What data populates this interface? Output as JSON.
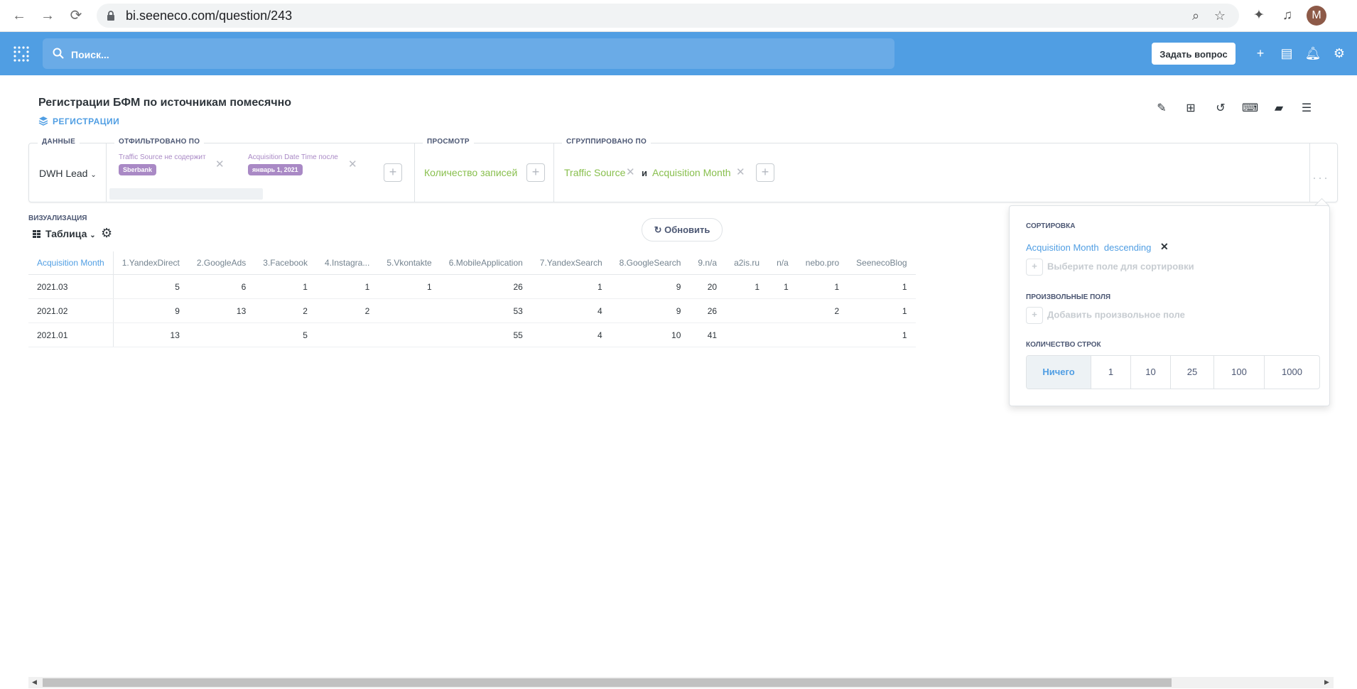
{
  "browser": {
    "url": "bi.seeneco.com/question/243",
    "profile_initial": "M"
  },
  "app": {
    "search_placeholder": "Поиск...",
    "ask_button": "Задать вопрос"
  },
  "question": {
    "title": "Регистрации БФМ по источникам помесячно",
    "collection": "РЕГИСТРАЦИИ"
  },
  "notebook": {
    "data_label": "ДАННЫЕ",
    "data_source": "DWH Lead",
    "filtered_label": "ОТФИЛЬТРОВАНО ПО",
    "filters": [
      {
        "field": "Traffic Source не содержит",
        "value": "Sberbank"
      },
      {
        "field": "Acquisition Date Time после",
        "value": "январь 1, 2021"
      }
    ],
    "view_label": "ПРОСМОТР",
    "metric": "Количество записей",
    "grouped_label": "СГРУППИРОВАНО ПО",
    "group_1": "Traffic Source",
    "group_and": "и",
    "group_2": "Acquisition Month"
  },
  "viz": {
    "label": "ВИЗУАЛИЗАЦИЯ",
    "type": "Таблица",
    "refresh": "Обновить"
  },
  "table": {
    "columns": [
      "Acquisition Month",
      "1.YandexDirect",
      "2.GoogleAds",
      "3.Facebook",
      "4.Instagra...",
      "5.Vkontakte",
      "6.MobileApplication",
      "7.YandexSearch",
      "8.GoogleSearch",
      "9.n/a",
      "a2is.ru",
      "n/a",
      "nebo.pro",
      "SeenecoBlog"
    ],
    "rows": [
      [
        "2021.03",
        "5",
        "6",
        "1",
        "1",
        "1",
        "26",
        "1",
        "9",
        "20",
        "1",
        "1",
        "1",
        "1"
      ],
      [
        "2021.02",
        "9",
        "13",
        "2",
        "2",
        "",
        "53",
        "4",
        "9",
        "26",
        "",
        "",
        "2",
        "1"
      ],
      [
        "2021.01",
        "13",
        "",
        "5",
        "",
        "",
        "55",
        "4",
        "10",
        "41",
        "",
        "",
        "",
        "1"
      ]
    ]
  },
  "popover": {
    "sort_header": "СОРТИРОВКА",
    "sort_field": "Acquisition Month",
    "sort_dir": "descending",
    "sort_add": "Выберите поле для сортировки",
    "custom_header": "ПРОИЗВОЛЬНЫЕ ПОЛЯ",
    "custom_add": "Добавить произвольное поле",
    "rows_header": "КОЛИЧЕСТВО СТРОК",
    "row_options": [
      "Ничего",
      "1",
      "10",
      "25",
      "100",
      "1000"
    ]
  },
  "colors": {
    "brand": "#509ee3",
    "filter": "#a989c5",
    "summarize": "#88bf4d"
  }
}
